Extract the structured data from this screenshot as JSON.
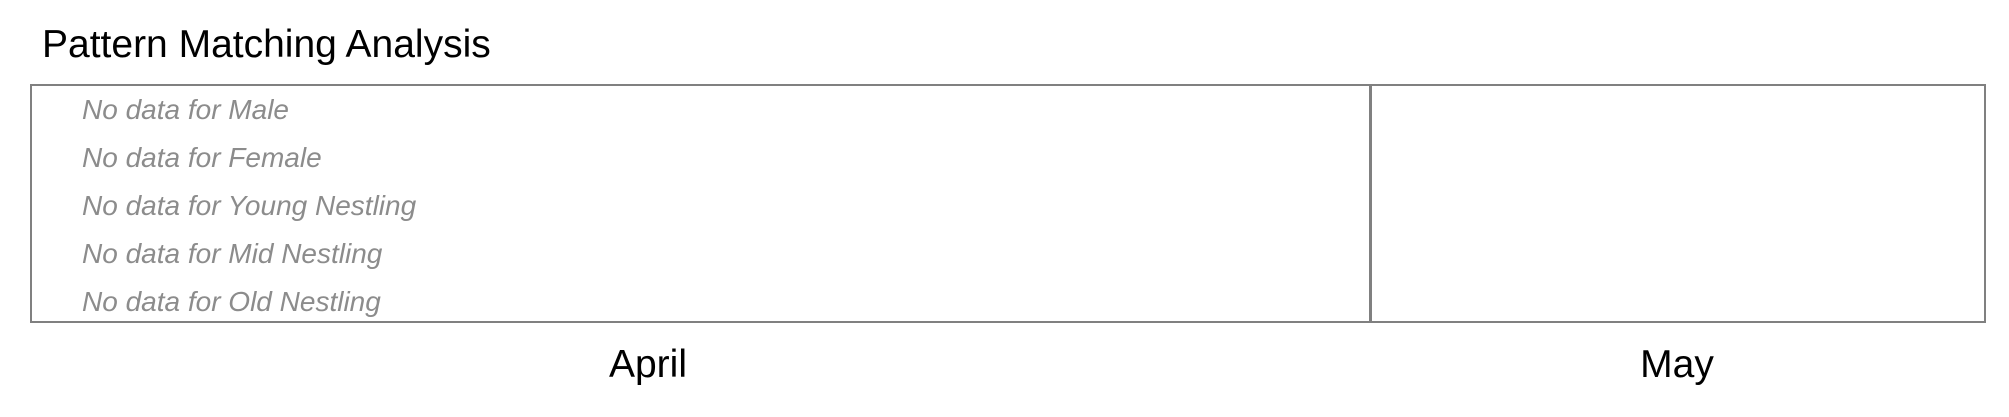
{
  "chart_data": {
    "type": "table",
    "title": "Pattern Matching Analysis",
    "panels": [
      "April",
      "May"
    ],
    "series": [
      {
        "name": "Male",
        "values": []
      },
      {
        "name": "Female",
        "values": []
      },
      {
        "name": "Young Nestling",
        "values": []
      },
      {
        "name": "Mid Nestling",
        "values": []
      },
      {
        "name": "Old Nestling",
        "values": []
      }
    ],
    "messages": [
      "No data for Male",
      "No data for Female",
      "No data for Young Nestling",
      "No data for Mid Nestling",
      "No data for Old Nestling"
    ],
    "colors": {
      "border": "#808080",
      "message": "#8c8c8c",
      "text": "#000000"
    }
  }
}
